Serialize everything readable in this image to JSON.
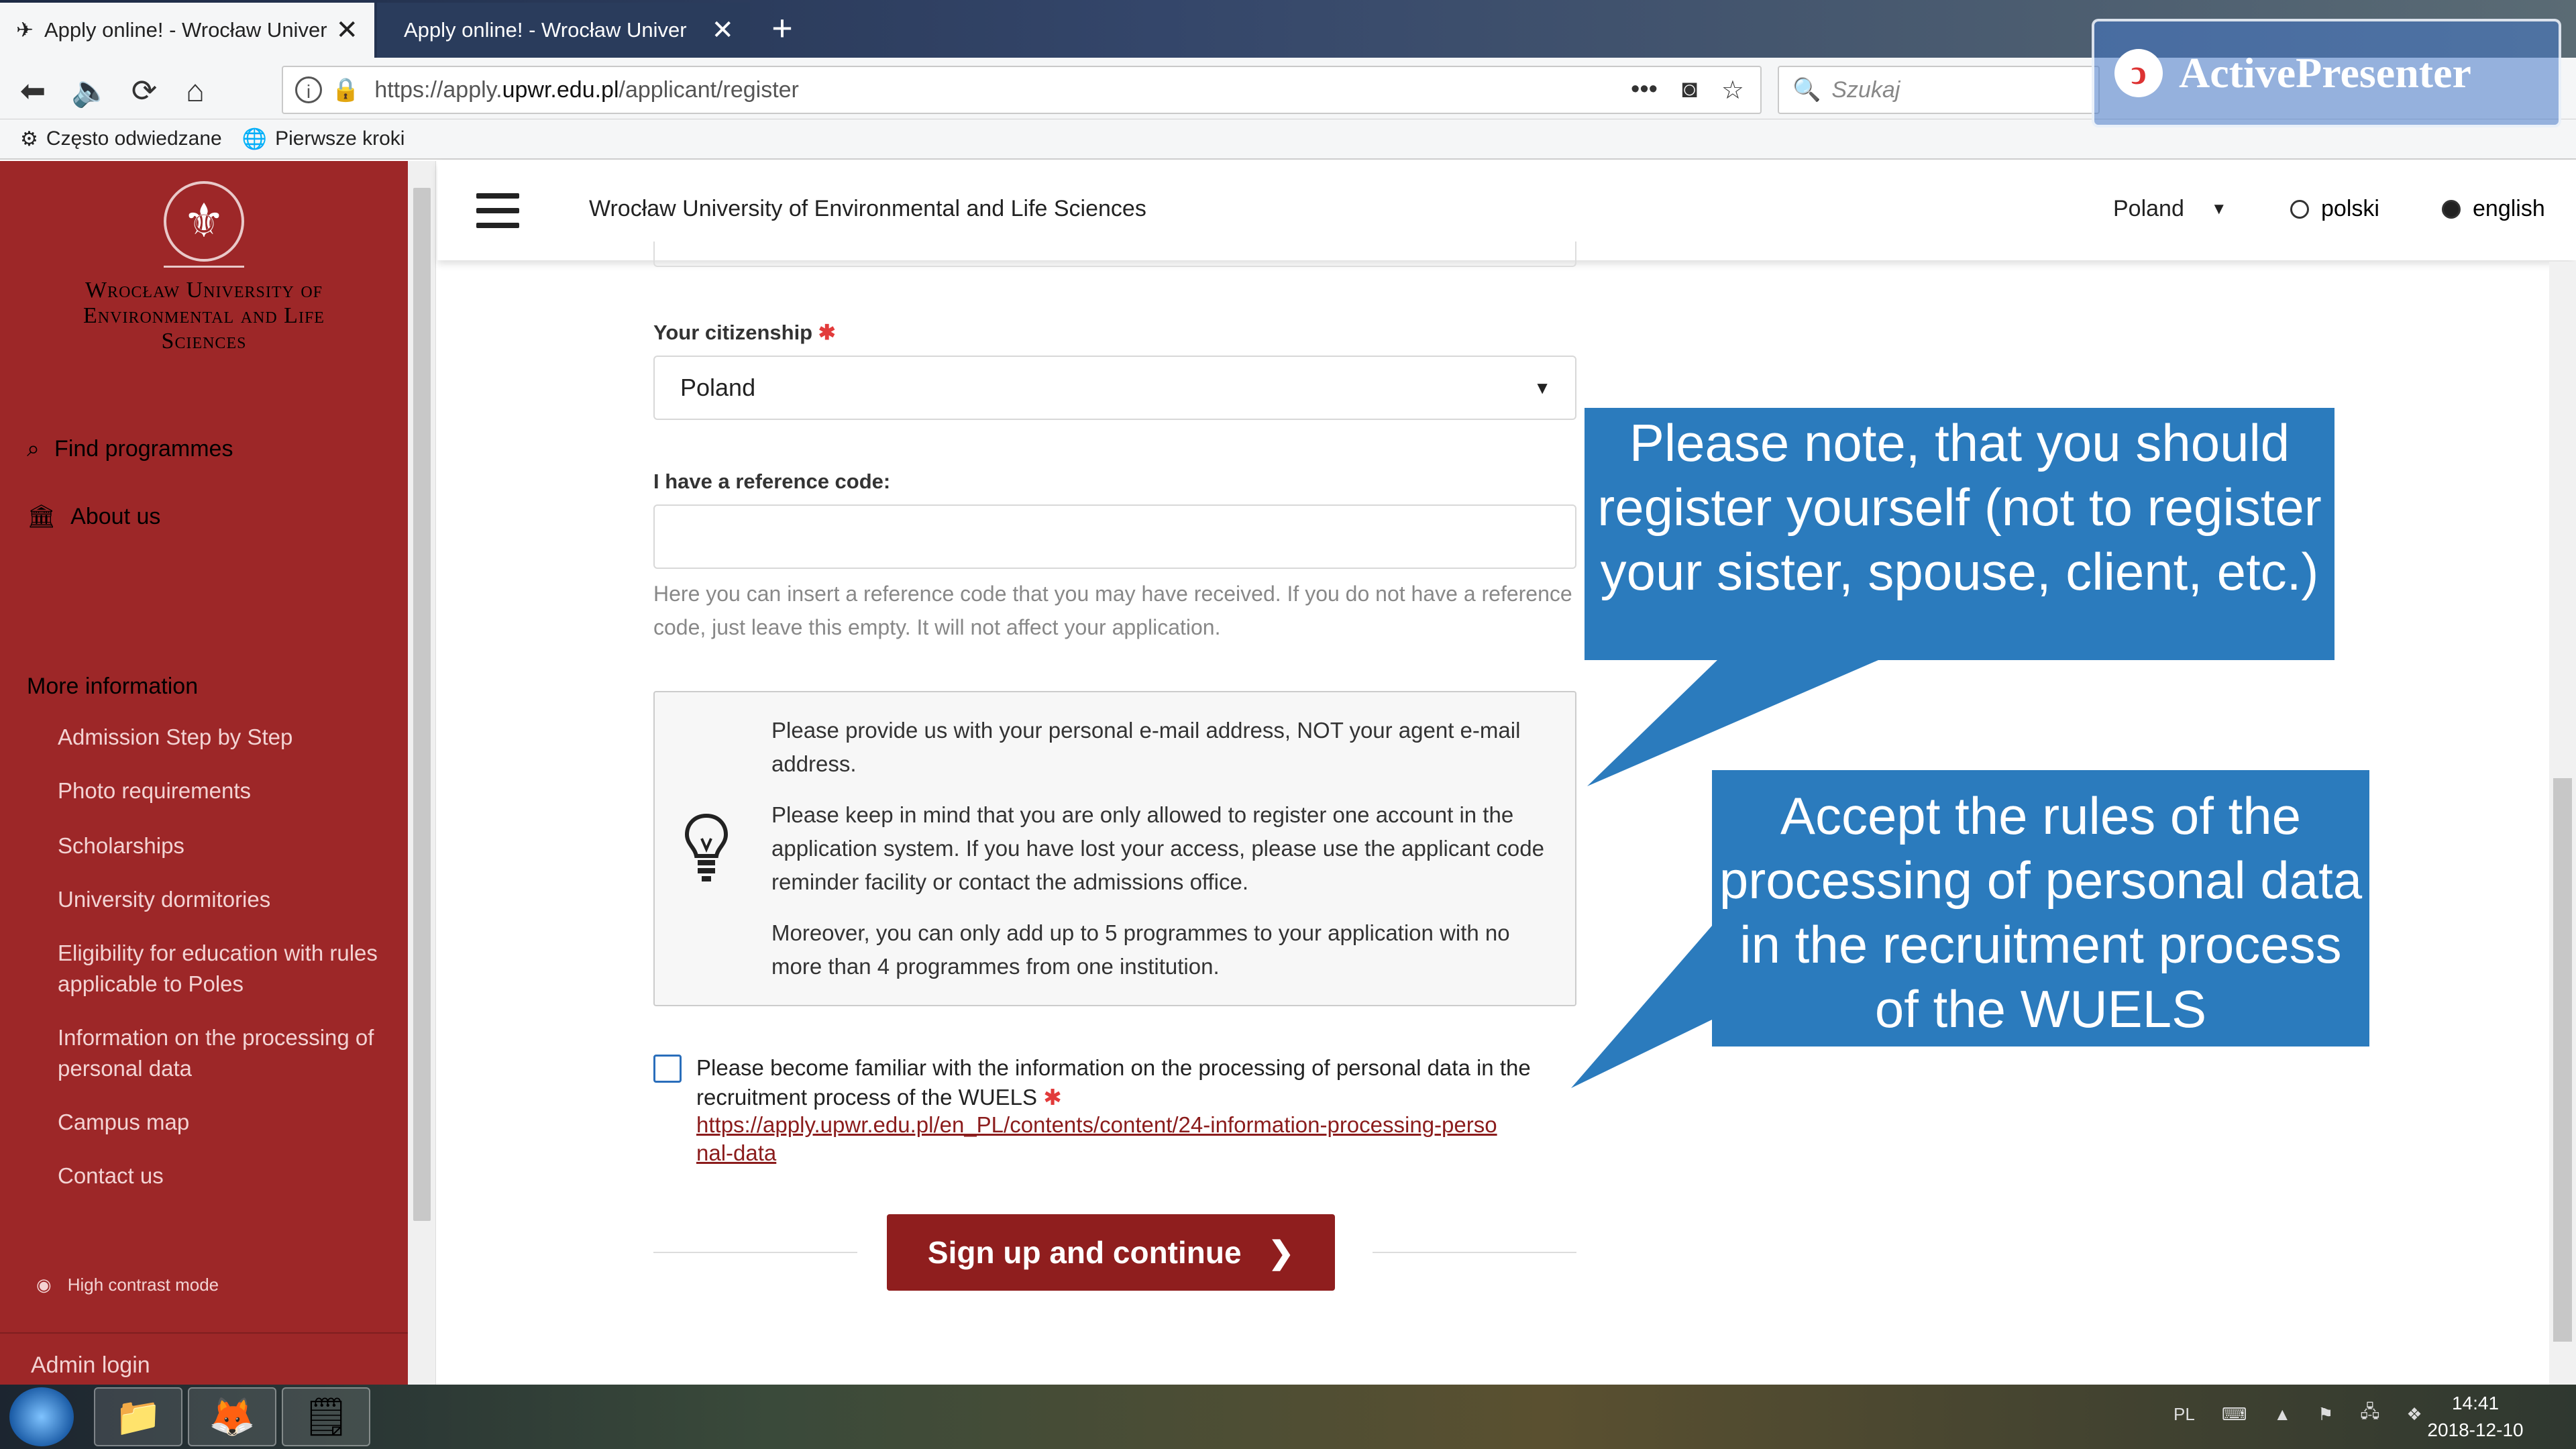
{
  "browser": {
    "tabs": [
      {
        "title": "Apply online! - Wrocław Univer",
        "active": true
      },
      {
        "title": "Apply online! - Wrocław Univer",
        "active": false
      }
    ],
    "url_prefix": "https://apply.",
    "url_domain": "upwr.edu.pl",
    "url_path": "/applicant/register",
    "search_placeholder": "Szukaj",
    "bookmarks": [
      "Często odwiedzane",
      "Pierwsze kroki"
    ]
  },
  "watermark": {
    "text": "ActivePresenter"
  },
  "sidebar": {
    "university_name": "Wrocław University of Environmental and Life Sciences",
    "nav": [
      "Find programmes",
      "About us"
    ],
    "more_info_heading": "More information",
    "more_info_items": [
      "Admission Step by Step",
      "Photo requirements",
      "Scholarships",
      "University dormitories",
      "Eligibility for education with rules applicable to Poles",
      "Information on the processing of personal data",
      "Campus map",
      "Contact us"
    ],
    "high_contrast": "High contrast mode",
    "admin_login": "Admin login"
  },
  "header": {
    "title": "Wrocław University of Environmental and Life Sciences",
    "country": "Poland",
    "languages": [
      {
        "label": "polski",
        "selected": false
      },
      {
        "label": "english",
        "selected": true
      }
    ]
  },
  "form": {
    "citizenship_label": "Your citizenship",
    "citizenship_value": "Poland",
    "reference_label": "I have a reference code:",
    "reference_value": "",
    "reference_help": "Here you can insert a reference code that you may have received. If you do not have a reference code, just leave this empty. It will not affect your application.",
    "info": [
      "Please provide us with your personal e-mail address, NOT your agent e-mail address.",
      "Please keep in mind that you are only allowed to register one account in the application system. If you have lost your access, please use the applicant code reminder facility or contact the admissions office.",
      "Moreover, you can only add up to 5 programmes to your application with no more than 4 programmes from one institution."
    ],
    "consent_text": "Please become familiar with the information on the processing of personal data in the recruitment process of the WUELS",
    "consent_link": "https://apply.upwr.edu.pl/en_PL/contents/content/24-information-processing-personal-data",
    "consent_checked": false,
    "submit_label": "Sign up and continue"
  },
  "callouts": [
    "Please note, that you should register yourself (not to register your sister, spouse, client, etc.)",
    "Accept the rules of the processing of personal data in the recruitment process of the WUELS"
  ],
  "taskbar": {
    "lang": "PL",
    "time": "14:41",
    "date": "2018-12-10"
  },
  "colors": {
    "brand": "#9d2728",
    "button": "#8f1e1e",
    "callout": "#2b7bbd"
  }
}
